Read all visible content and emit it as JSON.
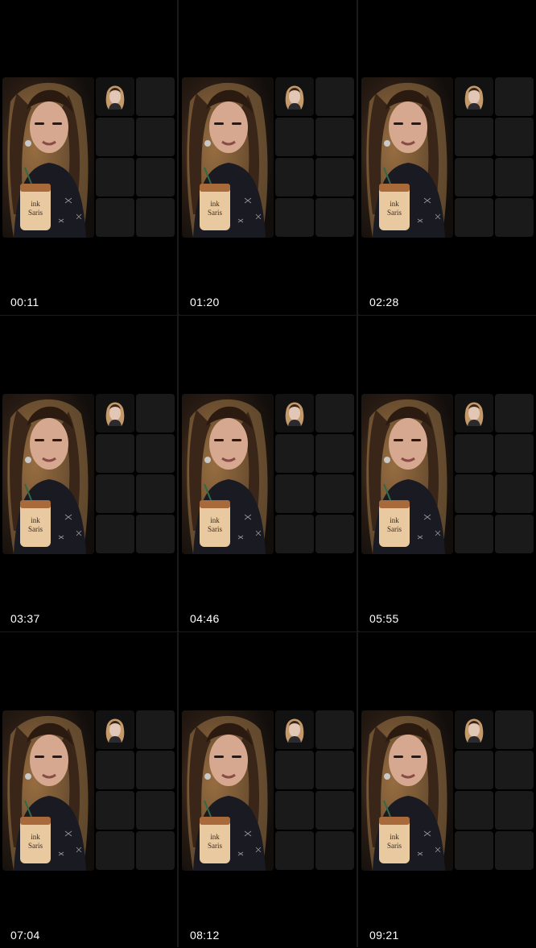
{
  "screen": {
    "background": "#000000",
    "divider_color": "#1a1a1a",
    "tile_color": "#1a1a1a"
  },
  "thumbnails": [
    {
      "timestamp": "00:11"
    },
    {
      "timestamp": "01:20"
    },
    {
      "timestamp": "02:28"
    },
    {
      "timestamp": "03:37"
    },
    {
      "timestamp": "04:46"
    },
    {
      "timestamp": "05:55"
    },
    {
      "timestamp": "07:04"
    },
    {
      "timestamp": "08:12"
    },
    {
      "timestamp": "09:21"
    }
  ],
  "cup_text": "ink\nSaris"
}
